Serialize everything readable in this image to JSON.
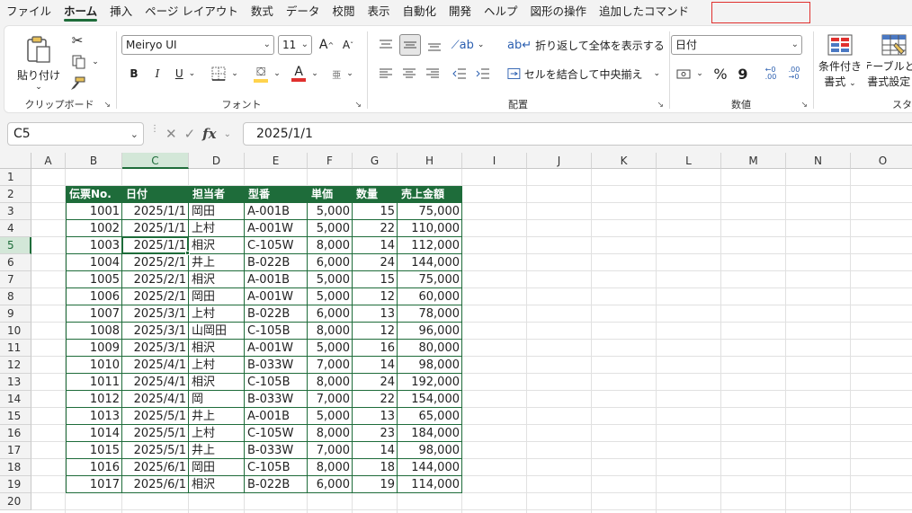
{
  "menu": {
    "tabs": [
      "ファイル",
      "ホーム",
      "挿入",
      "ページ レイアウト",
      "数式",
      "データ",
      "校閲",
      "表示",
      "自動化",
      "開発",
      "ヘルプ",
      "図形の操作",
      "追加したコマンド"
    ],
    "active_index": 1
  },
  "ribbon": {
    "clipboard": {
      "paste": "貼り付け",
      "label": "クリップボード"
    },
    "font": {
      "name": "Meiryo UI",
      "size": "11",
      "label": "フォント",
      "bold": "B",
      "italic": "I",
      "underline": "U",
      "grow": "A",
      "shrink": "A",
      "color": "A",
      "phonetic": "亜"
    },
    "alignment": {
      "wrap": "折り返して全体を表示する",
      "merge": "セルを結合して中央揃え",
      "label": "配置"
    },
    "number": {
      "format": "日付",
      "percent": "%",
      "comma": "9",
      "label": "数値"
    },
    "styles": {
      "conditional": "条件付き",
      "conditional2": "書式",
      "table": "テーブルとし",
      "table2": "書式設定",
      "label": "スタイル"
    },
    "colors": {
      "accent": "#1e6c3a",
      "fill": "#ffd34d",
      "fontcolor": "#e0302e"
    }
  },
  "formula_bar": {
    "name_box": "C5",
    "fx": "fx",
    "value": "2025/1/1"
  },
  "sheet": {
    "columns": [
      "A",
      "B",
      "C",
      "D",
      "E",
      "F",
      "G",
      "H",
      "I",
      "J",
      "K",
      "L",
      "M",
      "N",
      "O"
    ],
    "rows": [
      "1",
      "2",
      "3",
      "4",
      "5",
      "6",
      "7",
      "8",
      "9",
      "10",
      "11",
      "12",
      "13",
      "14",
      "15",
      "16",
      "17",
      "18",
      "19",
      "20"
    ],
    "selected_column": "C",
    "selected_row": "5",
    "table_headers": [
      "伝票No.",
      "日付",
      "担当者",
      "型番",
      "単価",
      "数量",
      "売上金額"
    ],
    "table_rows": [
      [
        "1001",
        "2025/1/1",
        "岡田",
        "A-001B",
        "5,000",
        "15",
        "75,000"
      ],
      [
        "1002",
        "2025/1/1",
        "上村",
        "A-001W",
        "5,000",
        "22",
        "110,000"
      ],
      [
        "1003",
        "2025/1/1",
        "相沢",
        "C-105W",
        "8,000",
        "14",
        "112,000"
      ],
      [
        "1004",
        "2025/2/1",
        "井上",
        "B-022B",
        "6,000",
        "24",
        "144,000"
      ],
      [
        "1005",
        "2025/2/1",
        "相沢",
        "A-001B",
        "5,000",
        "15",
        "75,000"
      ],
      [
        "1006",
        "2025/2/1",
        "岡田",
        "A-001W",
        "5,000",
        "12",
        "60,000"
      ],
      [
        "1007",
        "2025/3/1",
        "上村",
        "B-022B",
        "6,000",
        "13",
        "78,000"
      ],
      [
        "1008",
        "2025/3/1",
        "山岡田",
        "C-105B",
        "8,000",
        "12",
        "96,000"
      ],
      [
        "1009",
        "2025/3/1",
        "相沢",
        "A-001W",
        "5,000",
        "16",
        "80,000"
      ],
      [
        "1010",
        "2025/4/1",
        "上村",
        "B-033W",
        "7,000",
        "14",
        "98,000"
      ],
      [
        "1011",
        "2025/4/1",
        "相沢",
        "C-105B",
        "8,000",
        "24",
        "192,000"
      ],
      [
        "1012",
        "2025/4/1",
        "岡",
        "B-033W",
        "7,000",
        "22",
        "154,000"
      ],
      [
        "1013",
        "2025/5/1",
        "井上",
        "A-001B",
        "5,000",
        "13",
        "65,000"
      ],
      [
        "1014",
        "2025/5/1",
        "上村",
        "C-105W",
        "8,000",
        "23",
        "184,000"
      ],
      [
        "1015",
        "2025/5/1",
        "井上",
        "B-033W",
        "7,000",
        "14",
        "98,000"
      ],
      [
        "1016",
        "2025/6/1",
        "岡田",
        "C-105B",
        "8,000",
        "18",
        "144,000"
      ],
      [
        "1017",
        "2025/6/1",
        "相沢",
        "B-022B",
        "6,000",
        "19",
        "114,000"
      ]
    ]
  }
}
